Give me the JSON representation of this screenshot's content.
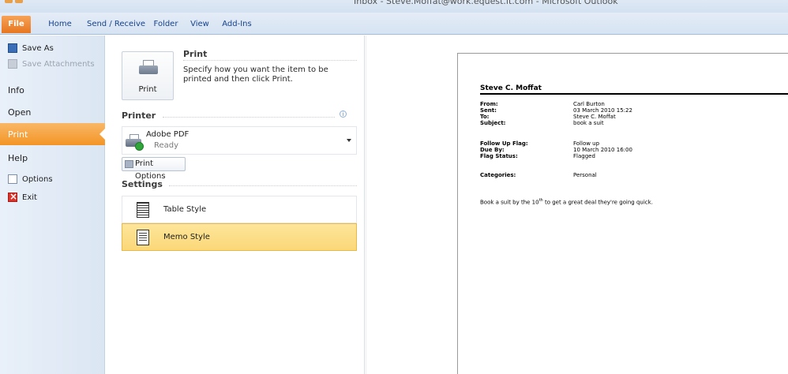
{
  "window": {
    "title": "Inbox - Steve.Moffat@work.equest.it.com - Microsoft Outlook"
  },
  "ribbon": {
    "tabs": [
      {
        "label": "File"
      },
      {
        "label": "Home"
      },
      {
        "label": "Send / Receive"
      },
      {
        "label": "Folder"
      },
      {
        "label": "View"
      },
      {
        "label": "Add-Ins"
      }
    ]
  },
  "nav": {
    "items": [
      {
        "label": "Save As",
        "icon": "save-as-icon"
      },
      {
        "label": "Save Attachments",
        "icon": "attachment-icon",
        "disabled": true
      },
      {
        "label": "Info"
      },
      {
        "label": "Open"
      },
      {
        "label": "Print",
        "active": true
      },
      {
        "label": "Help"
      },
      {
        "label": "Options",
        "icon": "options-icon"
      },
      {
        "label": "Exit",
        "icon": "exit-icon"
      }
    ]
  },
  "print_pane": {
    "heading": "Print",
    "description": "Specify how you want the item to be printed and then click Print.",
    "print_button_label": "Print",
    "printer_section": "Printer",
    "printer_name": "Adobe PDF",
    "printer_status": "Ready",
    "print_options_label": "Print Options",
    "settings_section": "Settings",
    "styles": [
      {
        "label": "Table Style",
        "icon": "table-style-icon",
        "selected": false
      },
      {
        "label": "Memo Style",
        "icon": "memo-style-icon",
        "selected": true
      }
    ]
  },
  "preview": {
    "sender": "Steve C. Moffat",
    "fields": [
      {
        "label": "From:",
        "value": "Carl Burton"
      },
      {
        "label": "Sent:",
        "value": "03 March 2010 15:22"
      },
      {
        "label": "To:",
        "value": "Steve C. Moffat"
      },
      {
        "label": "Subject:",
        "value": "book a suit"
      },
      {
        "label": "Follow Up Flag:",
        "value": "Follow up"
      },
      {
        "label": "Due By:",
        "value": "10 March 2010 16:00"
      },
      {
        "label": "Flag Status:",
        "value": "Flagged"
      },
      {
        "label": "Categories:",
        "value": "Personal"
      }
    ],
    "body_start": "Book a suit by the 10",
    "body_sup": "th",
    "body_end": " to get a great deal they're going quick."
  },
  "colors": {
    "accent": "#f39525",
    "selected_style": "#fbd878",
    "ribbon_text": "#15428b"
  }
}
